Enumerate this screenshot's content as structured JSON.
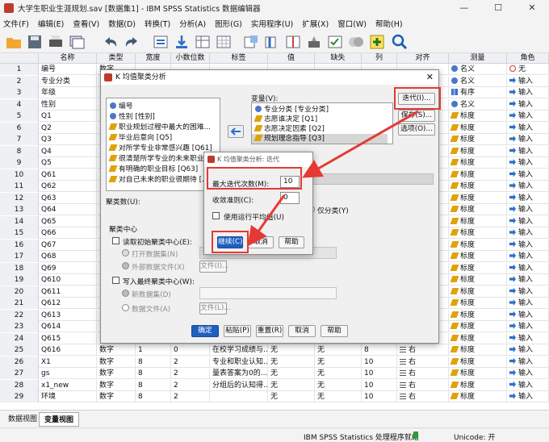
{
  "window": {
    "title": "大学生职业生涯规划.sav [数据集1] - IBM SPSS Statistics 数据编辑器",
    "minimize": "—",
    "maximize": "☐",
    "close": "✕"
  },
  "menu": [
    "文件(F)",
    "编辑(E)",
    "查看(V)",
    "数据(D)",
    "转换(T)",
    "分析(A)",
    "图形(G)",
    "实用程序(U)",
    "扩展(X)",
    "窗口(W)",
    "帮助(H)"
  ],
  "toolbar_icons": [
    "open-icon",
    "save-icon",
    "print-icon",
    "dialog-recall-icon",
    "undo-icon",
    "redo-icon",
    "goto-case-icon",
    "goto-variable-icon",
    "variables-icon",
    "find-icon",
    "insert-cases-icon",
    "insert-variable-icon",
    "split-file-icon",
    "weight-cases-icon",
    "select-cases-icon",
    "value-labels-icon",
    "use-sets-icon",
    "search-icon"
  ],
  "grid": {
    "columns": [
      "名称",
      "类型",
      "宽度",
      "小数位数",
      "标签",
      "值",
      "缺失",
      "列",
      "对齐",
      "测量",
      "角色"
    ],
    "rows": [
      {
        "n": "1",
        "name": "编号",
        "type": "数字",
        "width": "",
        "dec": "",
        "label": "",
        "val": "",
        "miss": "",
        "col": "",
        "align": "",
        "measure": "名义",
        "role": "无"
      },
      {
        "n": "2",
        "name": "专业分类",
        "type": "",
        "width": "",
        "dec": "",
        "label": "",
        "val": "",
        "miss": "",
        "col": "",
        "align": "",
        "measure": "名义",
        "role": "输入"
      },
      {
        "n": "3",
        "name": "年级",
        "type": "",
        "width": "",
        "dec": "",
        "label": "",
        "val": "",
        "miss": "",
        "col": "",
        "align": "",
        "measure": "有序",
        "role": "输入"
      },
      {
        "n": "4",
        "name": "性别",
        "type": "",
        "width": "",
        "dec": "",
        "label": "",
        "val": "",
        "miss": "",
        "col": "",
        "align": "",
        "measure": "名义",
        "role": "输入"
      },
      {
        "n": "5",
        "name": "Q1",
        "type": "",
        "width": "",
        "dec": "",
        "label": "",
        "val": "",
        "miss": "",
        "col": "",
        "align": "",
        "measure": "标度",
        "role": "输入"
      },
      {
        "n": "6",
        "name": "Q2",
        "type": "",
        "width": "",
        "dec": "",
        "label": "",
        "val": "",
        "miss": "",
        "col": "",
        "align": "",
        "measure": "标度",
        "role": "输入"
      },
      {
        "n": "7",
        "name": "Q3",
        "type": "",
        "width": "",
        "dec": "",
        "label": "",
        "val": "",
        "miss": "",
        "col": "",
        "align": "",
        "measure": "标度",
        "role": "输入"
      },
      {
        "n": "8",
        "name": "Q4",
        "type": "",
        "width": "",
        "dec": "",
        "label": "",
        "val": "",
        "miss": "",
        "col": "",
        "align": "",
        "measure": "标度",
        "role": "输入"
      },
      {
        "n": "9",
        "name": "Q5",
        "type": "",
        "width": "",
        "dec": "",
        "label": "",
        "val": "",
        "miss": "",
        "col": "",
        "align": "",
        "measure": "标度",
        "role": "输入"
      },
      {
        "n": "10",
        "name": "Q61",
        "type": "",
        "width": "",
        "dec": "",
        "label": "",
        "val": "",
        "miss": "",
        "col": "",
        "align": "",
        "measure": "标度",
        "role": "输入"
      },
      {
        "n": "11",
        "name": "Q62",
        "type": "",
        "width": "",
        "dec": "",
        "label": "",
        "val": "",
        "miss": "",
        "col": "",
        "align": "",
        "measure": "标度",
        "role": "输入"
      },
      {
        "n": "12",
        "name": "Q63",
        "type": "",
        "width": "",
        "dec": "",
        "label": "",
        "val": "",
        "miss": "",
        "col": "",
        "align": "",
        "measure": "标度",
        "role": "输入"
      },
      {
        "n": "13",
        "name": "Q64",
        "type": "",
        "width": "",
        "dec": "",
        "label": "",
        "val": "",
        "miss": "",
        "col": "",
        "align": "",
        "measure": "标度",
        "role": "输入"
      },
      {
        "n": "14",
        "name": "Q65",
        "type": "",
        "width": "",
        "dec": "",
        "label": "",
        "val": "",
        "miss": "",
        "col": "",
        "align": "",
        "measure": "标度",
        "role": "输入"
      },
      {
        "n": "15",
        "name": "Q66",
        "type": "",
        "width": "",
        "dec": "",
        "label": "",
        "val": "",
        "miss": "",
        "col": "",
        "align": "",
        "measure": "标度",
        "role": "输入"
      },
      {
        "n": "16",
        "name": "Q67",
        "type": "",
        "width": "",
        "dec": "",
        "label": "",
        "val": "",
        "miss": "",
        "col": "",
        "align": "",
        "measure": "标度",
        "role": "输入"
      },
      {
        "n": "17",
        "name": "Q68",
        "type": "",
        "width": "",
        "dec": "",
        "label": "",
        "val": "",
        "miss": "",
        "col": "",
        "align": "",
        "measure": "标度",
        "role": "输入"
      },
      {
        "n": "18",
        "name": "Q69",
        "type": "",
        "width": "",
        "dec": "",
        "label": "",
        "val": "",
        "miss": "",
        "col": "",
        "align": "",
        "measure": "标度",
        "role": "输入"
      },
      {
        "n": "19",
        "name": "Q610",
        "type": "",
        "width": "",
        "dec": "",
        "label": "",
        "val": "",
        "miss": "",
        "col": "",
        "align": "",
        "measure": "标度",
        "role": "输入"
      },
      {
        "n": "20",
        "name": "Q611",
        "type": "",
        "width": "",
        "dec": "",
        "label": "",
        "val": "",
        "miss": "",
        "col": "",
        "align": "",
        "measure": "标度",
        "role": "输入"
      },
      {
        "n": "21",
        "name": "Q612",
        "type": "",
        "width": "",
        "dec": "",
        "label": "",
        "val": "",
        "miss": "",
        "col": "",
        "align": "",
        "measure": "标度",
        "role": "输入"
      },
      {
        "n": "22",
        "name": "Q613",
        "type": "",
        "width": "",
        "dec": "",
        "label": "",
        "val": "",
        "miss": "",
        "col": "",
        "align": "",
        "measure": "标度",
        "role": "输入"
      },
      {
        "n": "23",
        "name": "Q614",
        "type": "",
        "width": "",
        "dec": "",
        "label": "",
        "val": "",
        "miss": "",
        "col": "",
        "align": "",
        "measure": "标度",
        "role": "输入"
      },
      {
        "n": "24",
        "name": "Q615",
        "type": "",
        "width": "",
        "dec": "",
        "label": "",
        "val": "",
        "miss": "",
        "col": "",
        "align": "",
        "measure": "标度",
        "role": "输入"
      },
      {
        "n": "25",
        "name": "Q616",
        "type": "数字",
        "width": "1",
        "dec": "0",
        "label": "在校学习成绩与...",
        "val": "无",
        "miss": "无",
        "col": "8",
        "align": "右",
        "measure": "标度",
        "role": "输入"
      },
      {
        "n": "26",
        "name": "X1",
        "type": "数字",
        "width": "8",
        "dec": "2",
        "label": "专业和职业认知...",
        "val": "无",
        "miss": "无",
        "col": "10",
        "align": "右",
        "measure": "标度",
        "role": "输入"
      },
      {
        "n": "27",
        "name": "gs",
        "type": "数字",
        "width": "8",
        "dec": "2",
        "label": "量表答案为0的...",
        "val": "无",
        "miss": "无",
        "col": "10",
        "align": "右",
        "measure": "标度",
        "role": "输入"
      },
      {
        "n": "28",
        "name": "x1_new",
        "type": "数字",
        "width": "8",
        "dec": "2",
        "label": "分组后的认知得...",
        "val": "无",
        "miss": "无",
        "col": "10",
        "align": "右",
        "measure": "标度",
        "role": "输入"
      },
      {
        "n": "29",
        "name": "环境",
        "type": "数字",
        "width": "8",
        "dec": "2",
        "label": "",
        "val": "无",
        "miss": "无",
        "col": "10",
        "align": "右",
        "measure": "标度",
        "role": "输入"
      }
    ]
  },
  "tabs": {
    "data_view": "数据视图",
    "variable_view": "变量视图"
  },
  "status": {
    "processor": "IBM SPSS Statistics 处理程序就绪",
    "unicode": "Unicode: 开"
  },
  "kmeans": {
    "title": "K 均值聚类分析",
    "source_vars": [
      "编号",
      "性别 [性别]",
      "职业规划过程中最大的困难...",
      "毕业后意向 [Q5]",
      "对所学专业非常感兴趣 [Q61]",
      "很清楚所学专业的未来职业...",
      "有明确的职业目标 [Q63]",
      "对自己未来的职业很期待 [..."
    ],
    "variables_label": "变量(V):",
    "target_vars": [
      "专业分类 [专业分类]",
      "志愿谁决定 [Q1]",
      "志愿决定因素 [Q2]",
      "规划理念指导 [Q3]"
    ],
    "btn_iterate": "迭代(I)...",
    "btn_save": "保存(S)...",
    "btn_options": "选项(O)...",
    "clusters_label": "聚类数(U):",
    "classify_only": "仅分类(Y)",
    "centers_group": "聚类中心",
    "read_initial": "读取初始聚类中心(E):",
    "open_dataset": "打开数据集(N)",
    "external_file": "外部数据文件(X)",
    "file_btn": "文件(I)...",
    "write_final": "写入最终聚类中心(W):",
    "new_dataset": "新数据集(D)",
    "data_file": "数据文件(A)",
    "file_btn2": "文件(L)...",
    "ok": "确定",
    "paste": "粘贴(P)",
    "reset": "重置(R)",
    "cancel": "取消",
    "help": "帮助"
  },
  "iterate": {
    "title": "K 均值聚类分析: 迭代",
    "max_iter_label": "最大迭代次数(M):",
    "max_iter_value": "10",
    "criterion_label": "收敛准则(C):",
    "criterion_value": "0",
    "running_means": "使用运行平均值(U)",
    "continue": "继续(C)",
    "cancel": "取消",
    "help": "帮助"
  },
  "colors": {
    "highlight": "#e53935",
    "primary_button": "#1f5fbf"
  }
}
